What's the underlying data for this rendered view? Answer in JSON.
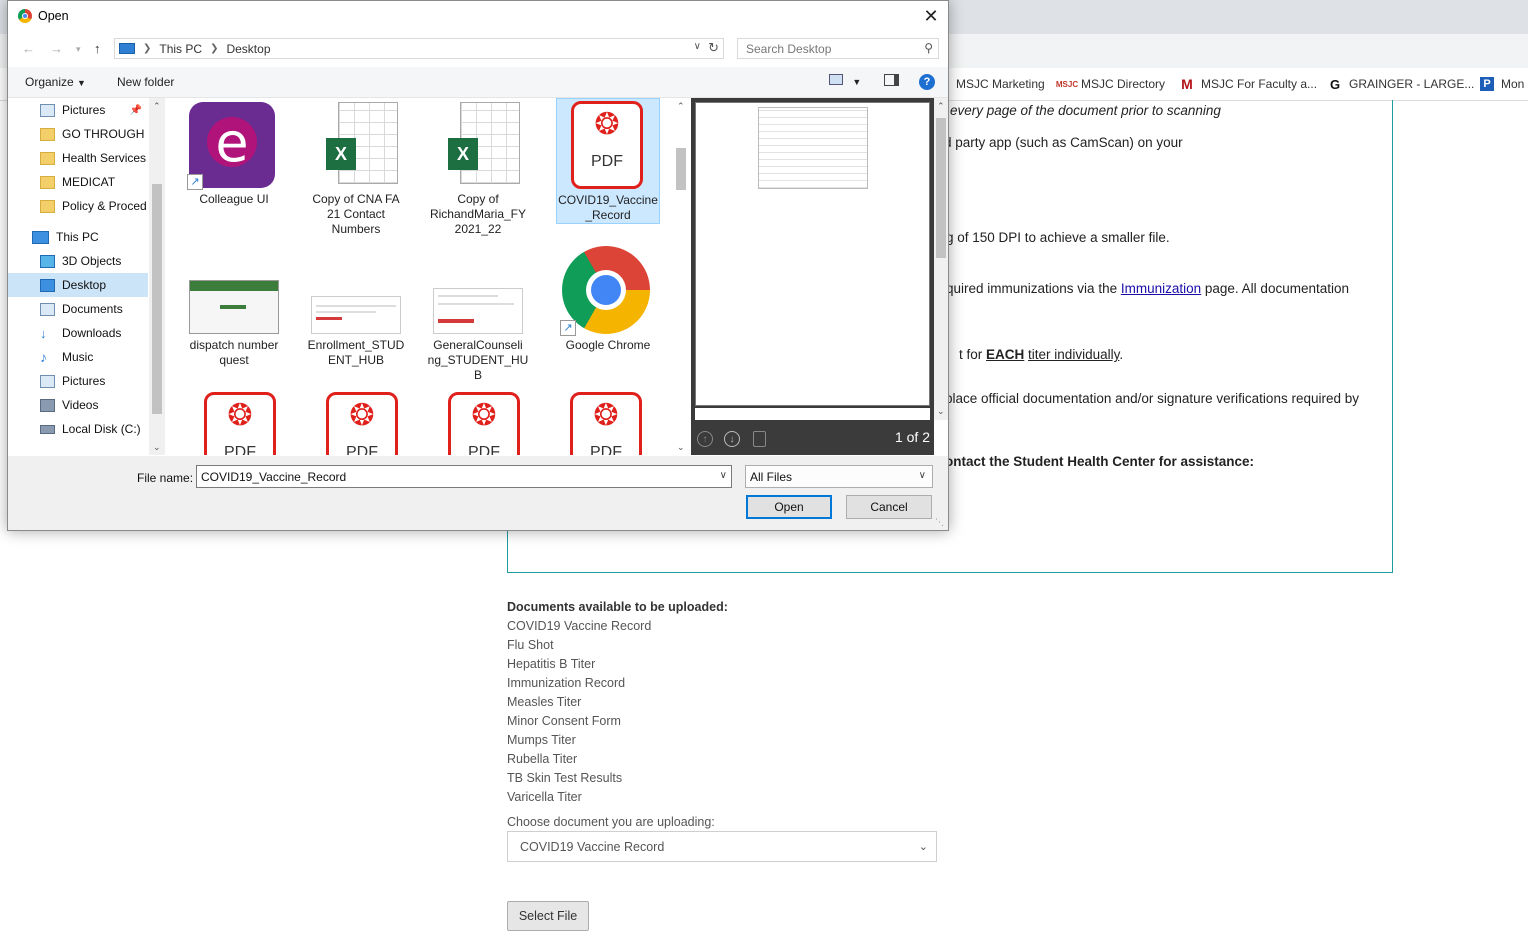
{
  "dialog": {
    "title": "Open",
    "close_label": "✕",
    "breadcrumb": [
      "This PC",
      "Desktop"
    ],
    "search_placeholder": "Search Desktop",
    "toolbar": {
      "organize": "Organize",
      "new_folder": "New folder",
      "help": "?"
    },
    "nav_items": [
      {
        "label": "Pictures",
        "icon": "pictures-icon"
      },
      {
        "label": "GO THROUGH",
        "icon": "folder-icon"
      },
      {
        "label": "Health Services",
        "icon": "folder-icon"
      },
      {
        "label": "MEDICAT",
        "icon": "folder-icon"
      },
      {
        "label": "Policy & Proced",
        "icon": "folder-icon"
      },
      {
        "label": "This PC",
        "icon": "pc-icon"
      },
      {
        "label": "3D Objects",
        "icon": "cube-icon"
      },
      {
        "label": "Desktop",
        "icon": "desktop-icon"
      },
      {
        "label": "Documents",
        "icon": "documents-icon"
      },
      {
        "label": "Downloads",
        "icon": "downloads-icon"
      },
      {
        "label": "Music",
        "icon": "music-icon"
      },
      {
        "label": "Pictures",
        "icon": "pictures-icon"
      },
      {
        "label": "Videos",
        "icon": "videos-icon"
      },
      {
        "label": "Local Disk (C:)",
        "icon": "disk-icon"
      }
    ],
    "selected_nav": "Desktop",
    "files": [
      {
        "name": "Colleague UI",
        "lines": [
          "Colleague UI"
        ],
        "icon": "colleague-shortcut-icon"
      },
      {
        "name": "Copy of CNA FA 21 Contact Numbers",
        "lines": [
          "Copy of CNA FA",
          "21 Contact",
          "Numbers"
        ],
        "icon": "excel-icon"
      },
      {
        "name": "Copy of RichandMaria_FY 2021_22",
        "lines": [
          "Copy of",
          "RichandMaria_FY",
          "2021_22"
        ],
        "icon": "excel-icon"
      },
      {
        "name": "COVID19_Vaccine_Record",
        "lines": [
          "COVID19_Vaccine",
          "_Record"
        ],
        "icon": "pdf-icon"
      },
      {
        "name": "dispatch number quest",
        "lines": [
          "dispatch number",
          "quest"
        ],
        "icon": "image-thumbnail-icon"
      },
      {
        "name": "Enrollment_STUDENT_HUB",
        "lines": [
          "Enrollment_STUD",
          "ENT_HUB"
        ],
        "icon": "image-thumbnail-icon"
      },
      {
        "name": "GeneralCounseling_STUDENT_HUB",
        "lines": [
          "GeneralCounseli",
          "ng_STUDENT_HU",
          "B"
        ],
        "icon": "image-thumbnail-icon"
      },
      {
        "name": "Google Chrome",
        "lines": [
          "Google Chrome"
        ],
        "icon": "chrome-shortcut-icon"
      },
      {
        "name": "",
        "lines": [],
        "icon": "pdf-icon"
      },
      {
        "name": "",
        "lines": [],
        "icon": "pdf-icon"
      },
      {
        "name": "",
        "lines": [],
        "icon": "pdf-icon"
      },
      {
        "name": "",
        "lines": [],
        "icon": "pdf-icon"
      }
    ],
    "pdf_label": "PDF",
    "preview": {
      "page_count": "1 of 2"
    },
    "file_name_label": "File name:",
    "file_name_value": "COVID19_Vaccine_Record",
    "file_type": "All Files",
    "open_button": "Open",
    "cancel_button": "Cancel"
  },
  "bookmarks": [
    "MSJC Marketing",
    "MSJC Directory",
    "MSJC For Faculty a...",
    "GRAINGER - LARGE...",
    "Mon"
  ],
  "page": {
    "lines": {
      "l1": "every page of the document prior to scanning",
      "l2": "d party app (such as CamScan) on your",
      "l3": "g of 150 DPI to achieve a smaller file.",
      "l4_pre": "quired immunizations via the ",
      "l4_link": "Immunization",
      "l4_post": " page.  All documentation",
      "l5_pre": "t for ",
      "l5_bold": "EACH",
      "l5_link": "titer individually",
      "l5_post": ".",
      "l6": "place official documentation and/or signature verifications required by",
      "l7": "ontact the Student Health Center for assistance:"
    },
    "docs_title": "Documents available to be uploaded:",
    "docs": [
      "COVID19 Vaccine Record",
      "Flu Shot",
      "Hepatitis B Titer",
      "Immunization Record",
      "Measles Titer",
      "Minor Consent Form",
      "Mumps Titer",
      "Rubella Titer",
      "TB Skin Test Results",
      "Varicella Titer"
    ],
    "choose_label": "Choose document you are uploading:",
    "selected_document": "COVID19 Vaccine Record",
    "select_file_button": "Select File"
  },
  "colors": {
    "accent_border": "#1f9ca0",
    "selection": "#cce8ff",
    "pdf_red": "#e0201b",
    "excel_green": "#1d6f42"
  }
}
